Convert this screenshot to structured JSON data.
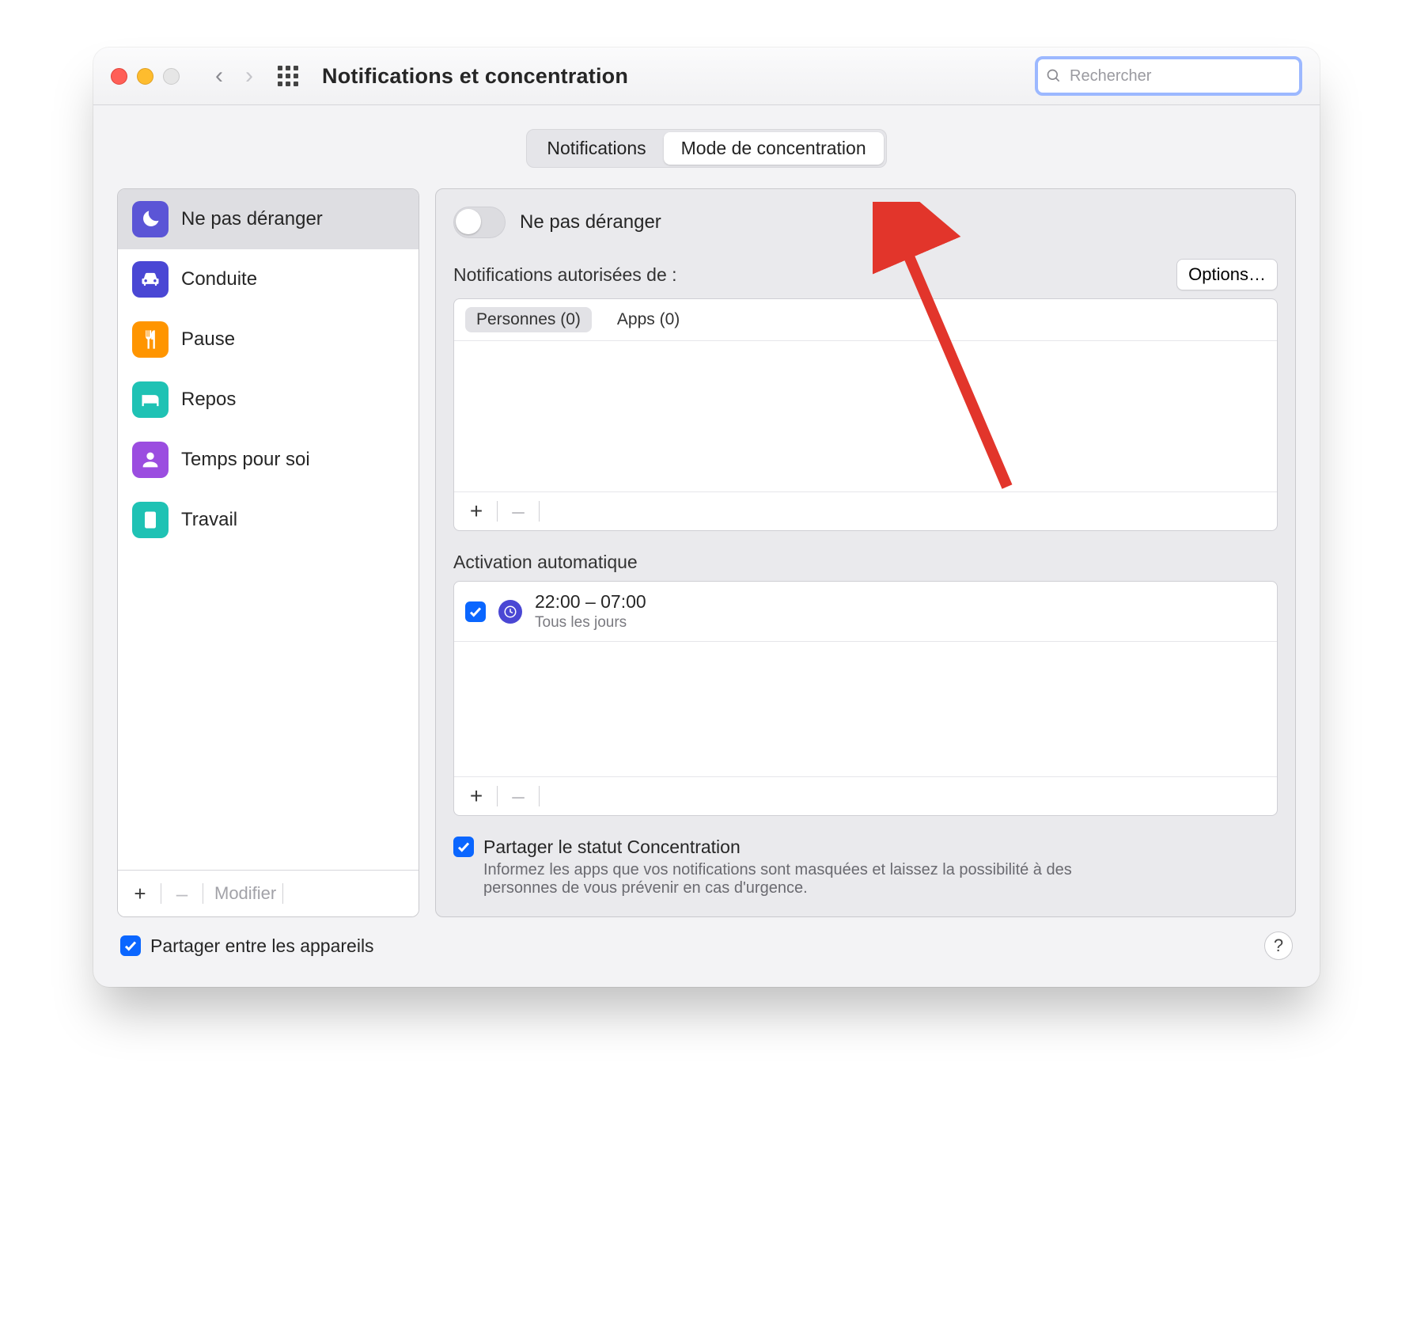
{
  "header": {
    "title": "Notifications et concentration",
    "search_placeholder": "Rechercher"
  },
  "tabs": {
    "notifications": "Notifications",
    "focus": "Mode de concentration",
    "active": "focus"
  },
  "sidebar": {
    "items": [
      {
        "label": "Ne pas déranger",
        "icon": "moon",
        "color": "#5b55d6",
        "selected": true
      },
      {
        "label": "Conduite",
        "icon": "car",
        "color": "#4a47d4",
        "selected": false
      },
      {
        "label": "Pause",
        "icon": "utensils",
        "color": "#ff9500",
        "selected": false
      },
      {
        "label": "Repos",
        "icon": "bed",
        "color": "#1fc2b4",
        "selected": false
      },
      {
        "label": "Temps pour soi",
        "icon": "person",
        "color": "#9b4de0",
        "selected": false
      },
      {
        "label": "Travail",
        "icon": "badge",
        "color": "#1fc2b4",
        "selected": false
      }
    ],
    "footer": {
      "add": "+",
      "remove": "–",
      "edit": "Modifier"
    }
  },
  "main": {
    "toggle_label": "Ne pas déranger",
    "toggle_on": false,
    "allowed_heading": "Notifications autorisées de :",
    "options_label": "Options…",
    "chips": {
      "people": "Personnes (0)",
      "apps": "Apps (0)",
      "active": "people"
    },
    "auto_heading": "Activation automatique",
    "schedule": {
      "enabled": true,
      "time": "22:00 – 07:00",
      "sub": "Tous les jours"
    },
    "share_status": {
      "checked": true,
      "title": "Partager le statut Concentration",
      "desc": "Informez les apps que vos notifications sont masquées et laissez la possibilité à des personnes de vous prévenir en cas d'urgence."
    }
  },
  "bottom": {
    "share_devices_checked": true,
    "share_devices_label": "Partager entre les appareils"
  },
  "annotations": {
    "arrow_target": "tab-focus",
    "circle_target": "sidebar-add"
  }
}
